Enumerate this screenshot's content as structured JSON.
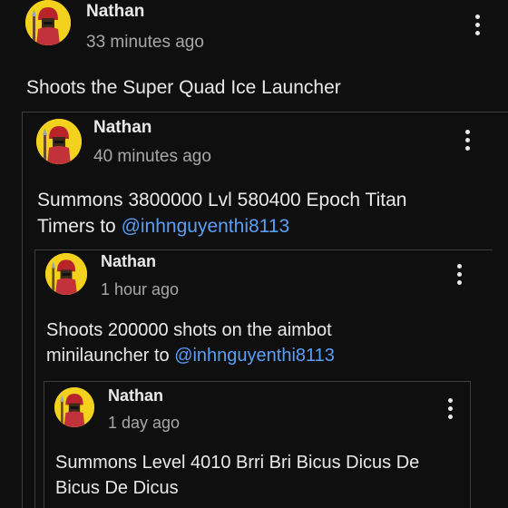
{
  "comments": [
    {
      "author": "Nathan",
      "time": "33 minutes ago",
      "text": "Shoots the Super Quad Ice Launcher",
      "text_line2": "",
      "mention": ""
    },
    {
      "author": "Nathan",
      "time": "40 minutes ago",
      "text": "Summons 3800000 Lvl 580400 Epoch Titan",
      "text_line2": "Timers to ",
      "mention": "@inhnguyenthi8113"
    },
    {
      "author": "Nathan",
      "time": "1 hour ago",
      "text": "Shoots 200000 shots on the aimbot",
      "text_line2": "minilauncher to ",
      "mention": "@inhnguyenthi8113"
    },
    {
      "author": "Nathan",
      "time": "1 day ago",
      "text": "Summons Level 4010 Brri Bri Bicus Dicus De",
      "text_line2": "Bicus De Dicus",
      "mention": ""
    }
  ],
  "colors": {
    "background": "#0f0f10",
    "text": "#e9e9e9",
    "timestamp": "#a8a8a8",
    "mention": "#5b9ff5",
    "avatar_bg": "#f2d21c",
    "thread_line": "#3d3d3d"
  },
  "icons": {
    "avatar": "spartan-warrior-avatar-icon",
    "menu": "more-vertical-icon"
  }
}
